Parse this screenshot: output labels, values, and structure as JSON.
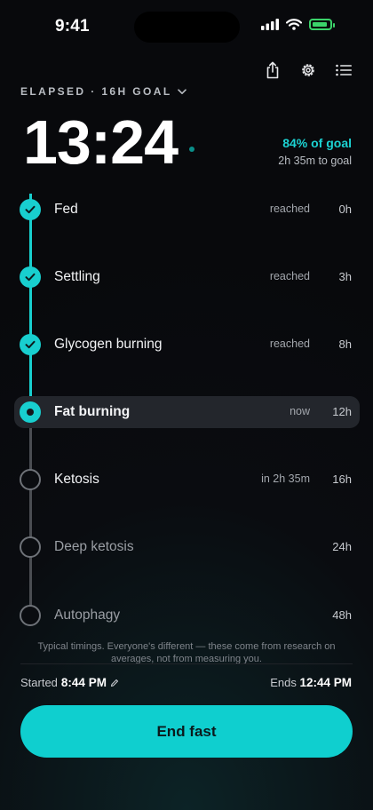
{
  "status_bar": {
    "time": "9:41"
  },
  "header": {
    "elapsed_label": "ELAPSED · 16H GOAL",
    "elapsed_time": "13:24",
    "goal_percent": "84% of goal",
    "goal_remaining": "2h 35m to goal"
  },
  "toolbar": {
    "icons": [
      "share-icon",
      "gear-icon",
      "list-icon"
    ]
  },
  "stages": [
    {
      "name": "Fed",
      "status": "reached",
      "hour": "0h",
      "state": "done"
    },
    {
      "name": "Settling",
      "status": "reached",
      "hour": "3h",
      "state": "done"
    },
    {
      "name": "Glycogen burning",
      "status": "reached",
      "hour": "8h",
      "state": "done"
    },
    {
      "name": "Fat burning",
      "status": "now",
      "hour": "12h",
      "state": "current"
    },
    {
      "name": "Ketosis",
      "status": "in 2h 35m",
      "hour": "16h",
      "state": "upcoming"
    },
    {
      "name": "Deep ketosis",
      "status": "",
      "hour": "24h",
      "state": "upcoming"
    },
    {
      "name": "Autophagy",
      "status": "",
      "hour": "48h",
      "state": "upcoming"
    }
  ],
  "footer": {
    "disclaimer": "Typical timings. Everyone's different — these come from research on averages, not from measuring you.",
    "started_label": "Started",
    "started_time": "8:44 PM",
    "ends_label": "Ends",
    "ends_time": "12:44 PM",
    "end_button": "End fast"
  },
  "colors": {
    "accent": "#18cfcf",
    "background": "#0a0c10",
    "battery": "#3bd36a"
  }
}
